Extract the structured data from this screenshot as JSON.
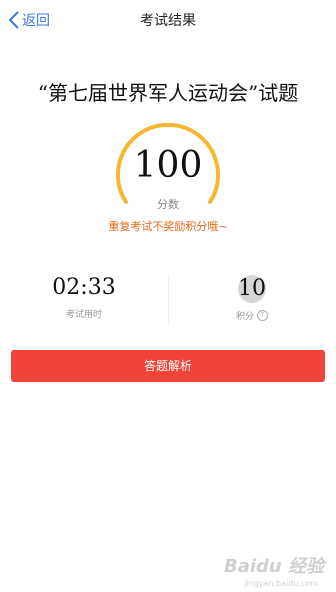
{
  "nav": {
    "back_label": "返回",
    "title": "考试结果"
  },
  "exam": {
    "title": "“第七届世界军人运动会”试题"
  },
  "result": {
    "score": "100",
    "score_unit": "分数",
    "notice": "重复考试不奖励积分哦~"
  },
  "stats": {
    "time_value": "02:33",
    "time_label": "考试用时",
    "points_value": "10",
    "points_label": "积分"
  },
  "actions": {
    "analysis_label": "答题解析"
  },
  "watermark": {
    "text": "Baidu 经验",
    "sub": "jingyan.baidu.com"
  },
  "colors": {
    "accent": "#f0443a",
    "back": "#3b7ae6",
    "gauge": "#f5b731",
    "notice": "#e8681a"
  },
  "icons": {
    "back": "chevron-left-icon",
    "help": "question-circle-icon"
  }
}
